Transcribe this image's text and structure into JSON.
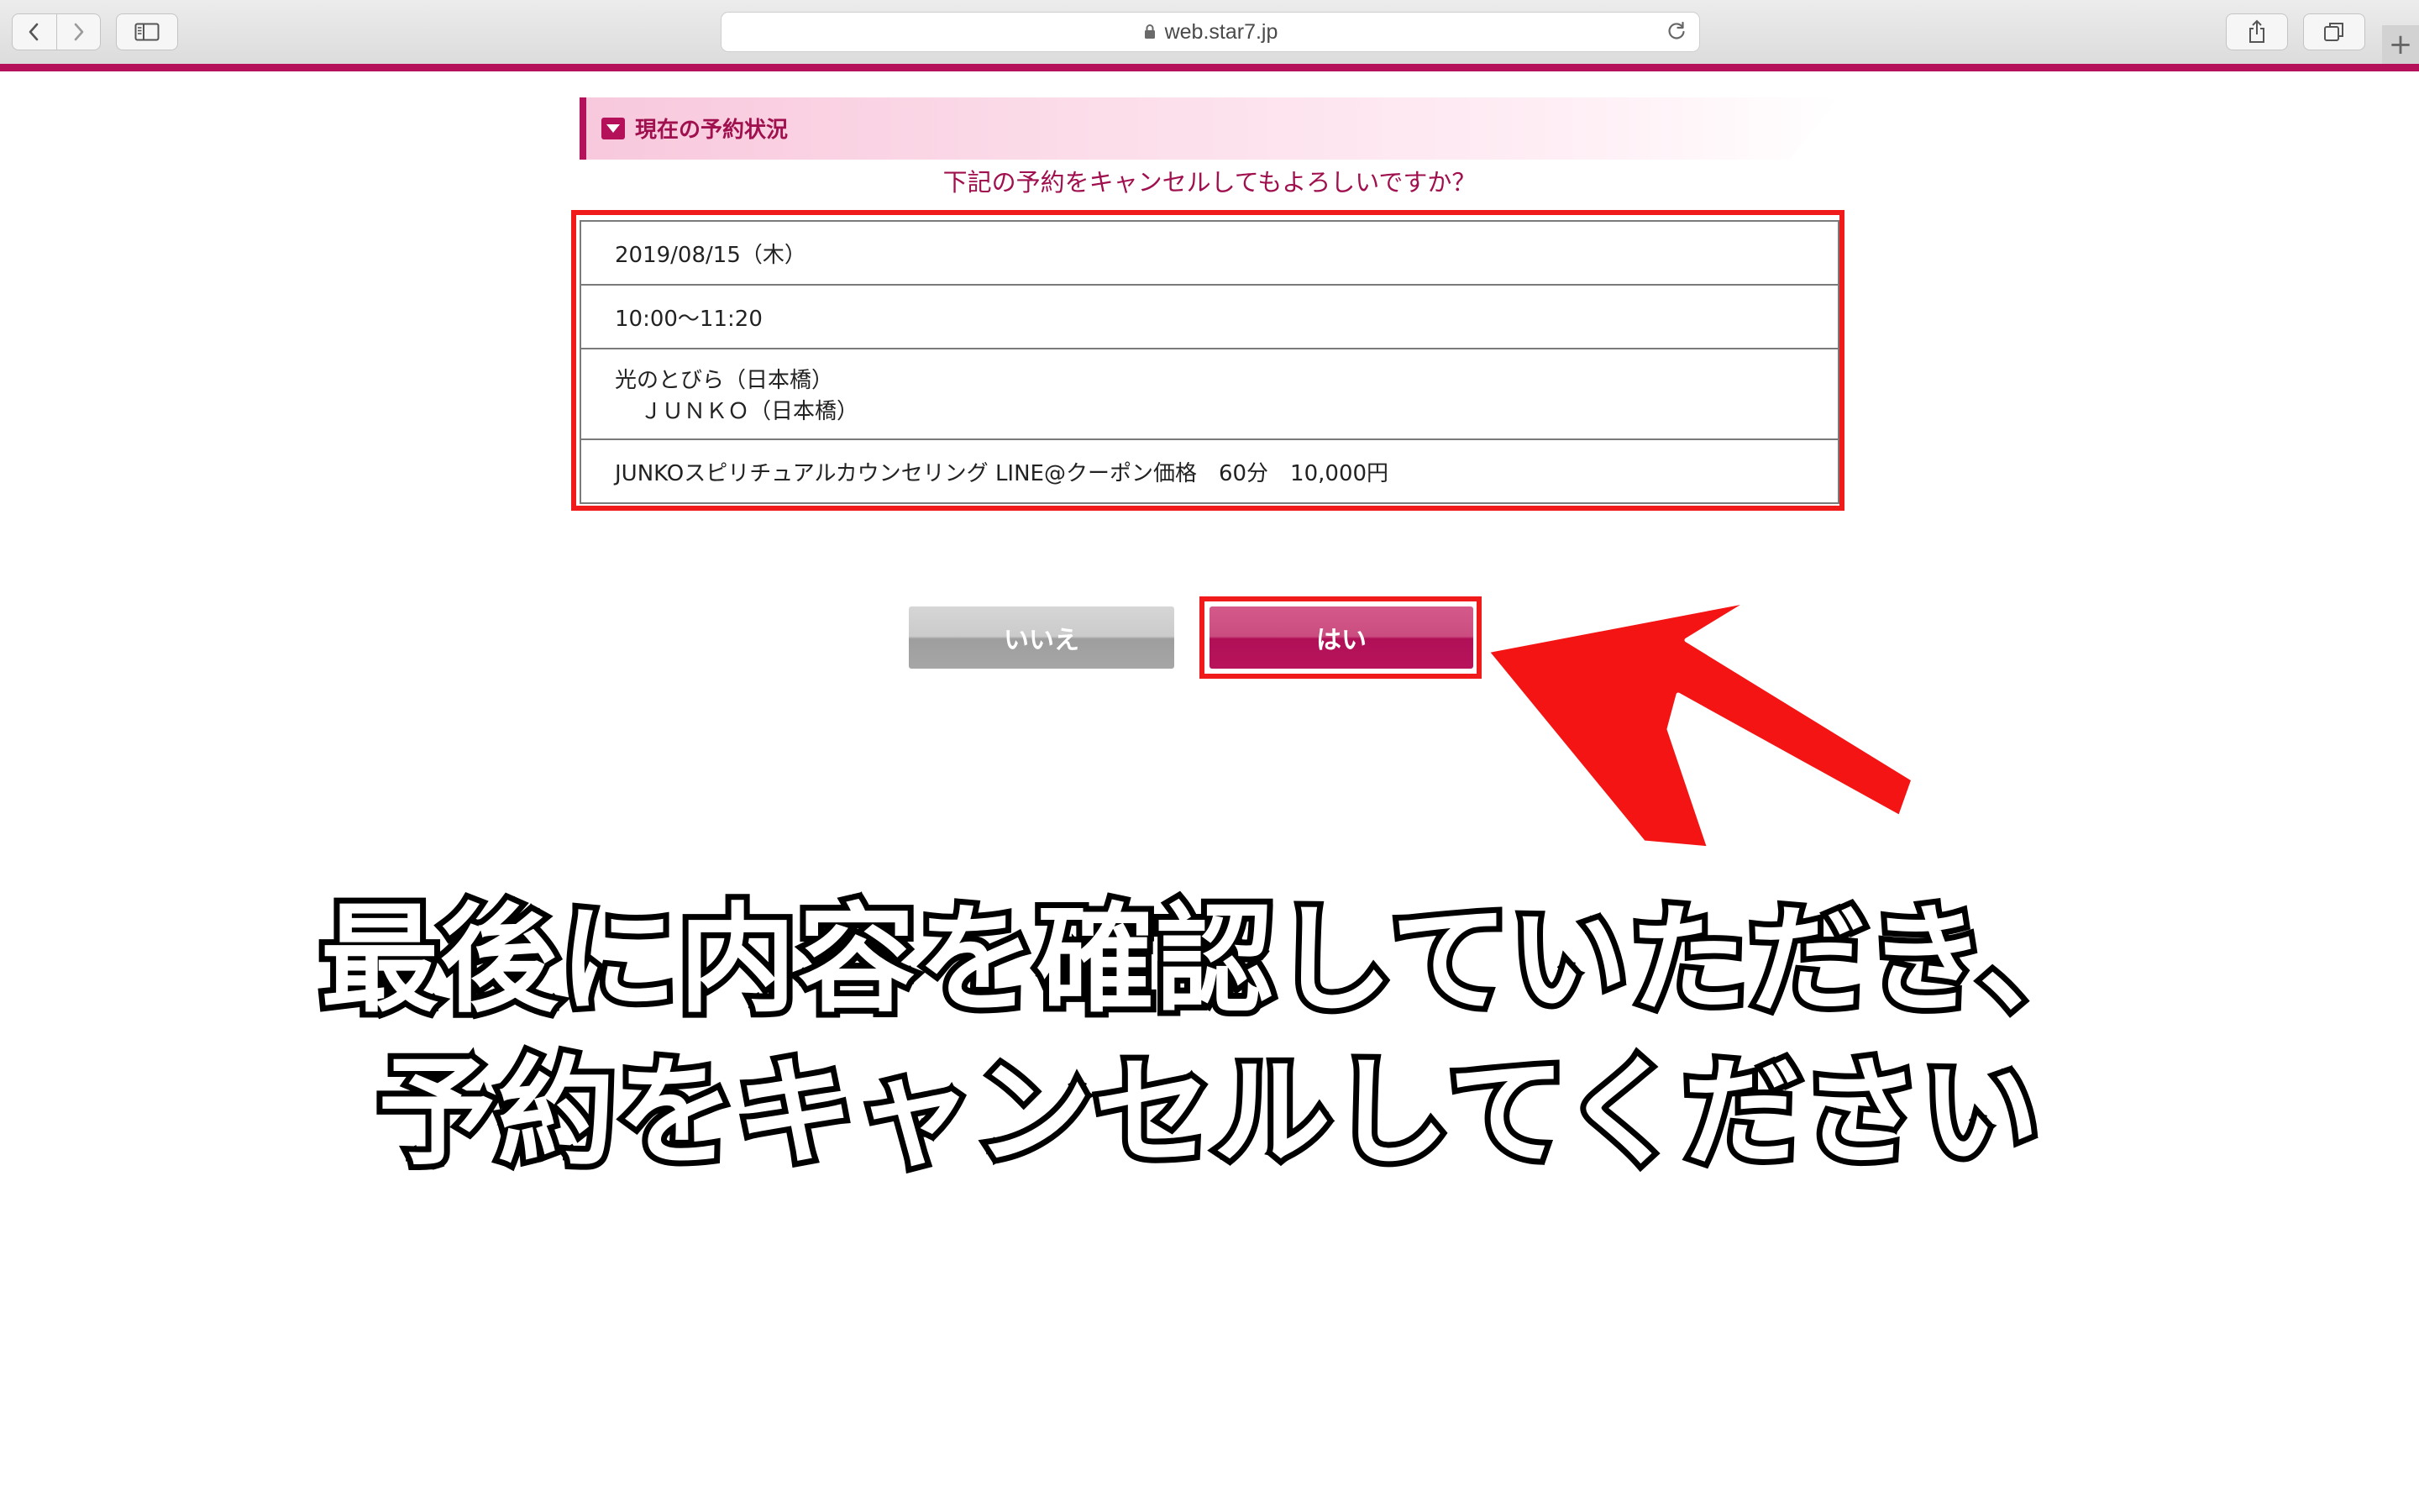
{
  "browser": {
    "url": "web.star7.jp",
    "icons": {
      "back": "chevron-left-icon",
      "forward": "chevron-right-icon",
      "sidebar": "sidebar-icon",
      "lock": "lock-icon",
      "reload": "reload-icon",
      "share": "share-icon",
      "tabs": "tabs-icon",
      "new_tab": "plus-icon"
    },
    "accent_color": "#b4115a"
  },
  "section": {
    "title": "現在の予約状況",
    "icon": "triangle-down-icon"
  },
  "confirm_question": "下記の予約をキャンセルしてもよろしいですか？",
  "reservation": {
    "date": "2019/08/15（木）",
    "time": "10:00〜11:20",
    "place": "光のとびら（日本橋）",
    "staff": "ＪＵＮＫＯ（日本橋）",
    "menu": "JUNKOスピリチュアルカウンセリング LINE@クーポン価格　60分　10,000円"
  },
  "buttons": {
    "no_label": "いいえ",
    "yes_label": "はい"
  },
  "annotation": {
    "highlight_color": "#f11a1a",
    "arrow_icon": "arrow-icon",
    "caption_line1": "最後に内容を確認していただき、",
    "caption_line2": "予約をキャンセルしてください"
  }
}
